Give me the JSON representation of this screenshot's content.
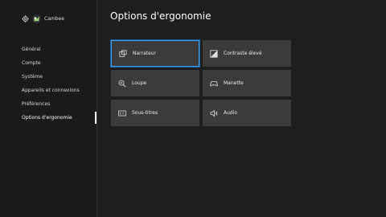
{
  "profile": {
    "name": "Cambee"
  },
  "nav": {
    "items": [
      {
        "label": "Général"
      },
      {
        "label": "Compte"
      },
      {
        "label": "Système"
      },
      {
        "label": "Appareils et connexions"
      },
      {
        "label": "Préférences"
      },
      {
        "label": "Options d'ergonomie"
      }
    ],
    "selected": "Options d'ergonomie"
  },
  "page": {
    "title": "Options d'ergonomie"
  },
  "tiles": [
    {
      "label": "Narrateur",
      "icon": "narrator-icon",
      "focused": true
    },
    {
      "label": "Contraste élevé",
      "icon": "high-contrast-icon"
    },
    {
      "label": "Loupe",
      "icon": "magnifier-icon"
    },
    {
      "label": "Manette",
      "icon": "controller-icon"
    },
    {
      "label": "Sous-titres",
      "icon": "closed-captions-icon"
    },
    {
      "label": "Audio",
      "icon": "speaker-icon"
    }
  ],
  "colors": {
    "focus": "#3aa0f3",
    "tile": "#3b3b3b",
    "background": "#1e1e1e"
  }
}
